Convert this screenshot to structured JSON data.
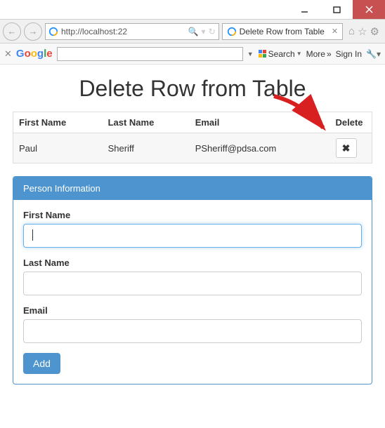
{
  "browser": {
    "url": "http://localhost:22",
    "tab_title": "Delete Row from Table",
    "search_label": "Search",
    "more_label": "More",
    "signin_label": "Sign In"
  },
  "page": {
    "title": "Delete Row from Table"
  },
  "table": {
    "headers": {
      "first": "First Name",
      "last": "Last Name",
      "email": "Email",
      "delete": "Delete"
    },
    "rows": [
      {
        "first": "Paul",
        "last": "Sheriff",
        "email": "PSheriff@pdsa.com"
      }
    ]
  },
  "panel": {
    "title": "Person Information",
    "labels": {
      "first": "First Name",
      "last": "Last Name",
      "email": "Email"
    },
    "values": {
      "first": "",
      "last": "",
      "email": ""
    },
    "add_label": "Add"
  }
}
